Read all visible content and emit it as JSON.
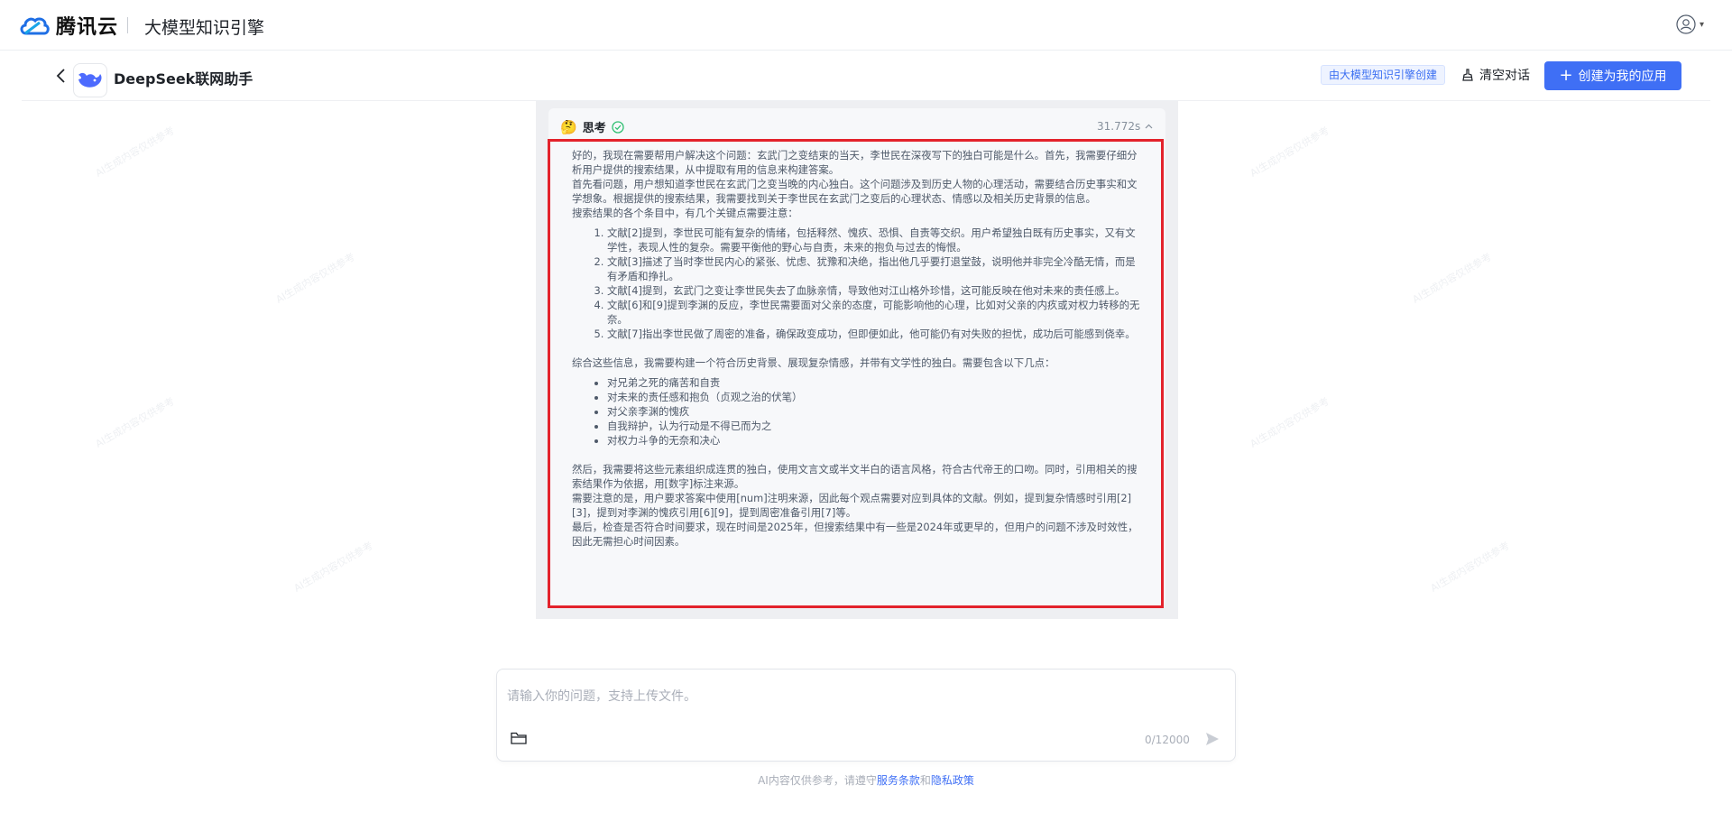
{
  "header": {
    "brand": "腾讯云",
    "product": "大模型知识引擎"
  },
  "subheader": {
    "app_title": "DeepSeek联网助手",
    "creator_tag": "由大模型知识引擎创建",
    "clear_label": "清空对话",
    "create_label": "创建为我的应用"
  },
  "thinking": {
    "emoji": "🤔",
    "label": "思考",
    "duration": "31.772s",
    "intro": [
      "好的，我现在需要帮用户解决这个问题：玄武门之变结束的当天，李世民在深夜写下的独白可能是什么。首先，我需要仔细分析用户提供的搜索结果，从中提取有用的信息来构建答案。",
      "首先看问题，用户想知道李世民在玄武门之变当晚的内心独白。这个问题涉及到历史人物的心理活动，需要结合历史事实和文学想象。根据提供的搜索结果，我需要找到关于李世民在玄武门之变后的心理状态、情感以及相关历史背景的信息。",
      "搜索结果的各个条目中，有几个关键点需要注意："
    ],
    "points": [
      "文献[2]提到，李世民可能有复杂的情绪，包括释然、愧疚、恐惧、自责等交织。用户希望独白既有历史事实，又有文学性，表现人性的复杂。需要平衡他的野心与自责，未来的抱负与过去的悔恨。",
      "文献[3]描述了当时李世民内心的紧张、忧虑、犹豫和决绝，指出他几乎要打退堂鼓，说明他并非完全冷酷无情，而是有矛盾和挣扎。",
      "文献[4]提到，玄武门之变让李世民失去了血脉亲情，导致他对江山格外珍惜，这可能反映在他对未来的责任感上。",
      "文献[6]和[9]提到李渊的反应，李世民需要面对父亲的态度，可能影响他的心理，比如对父亲的内疚或对权力转移的无奈。",
      "文献[7]指出李世民做了周密的准备，确保政变成功，但即便如此，他可能仍有对失败的担忧，成功后可能感到侥幸。"
    ],
    "summary": "综合这些信息，我需要构建一个符合历史背景、展现复杂情感，并带有文学性的独白。需要包含以下几点：",
    "bullets": [
      "对兄弟之死的痛苦和自责",
      "对未来的责任感和抱负（贞观之治的伏笔）",
      "对父亲李渊的愧疚",
      "自我辩护，认为行动是不得已而为之",
      "对权力斗争的无奈和决心"
    ],
    "outro": [
      "然后，我需要将这些元素组织成连贯的独白，使用文言文或半文半白的语言风格，符合古代帝王的口吻。同时，引用相关的搜索结果作为依据，用[数字]标注来源。",
      "需要注意的是，用户要求答案中使用[num]注明来源，因此每个观点需要对应到具体的文献。例如，提到复杂情感时引用[2][3]，提到对李渊的愧疚引用[6][9]，提到周密准备引用[7]等。",
      "最后，检查是否符合时间要求，现在时间是2025年，但搜索结果中有一些是2024年或更早的，但用户的问题不涉及时效性，因此无需担心时间因素。"
    ]
  },
  "input": {
    "placeholder": "请输入你的问题，支持上传文件。",
    "value": "",
    "char_count": "0/12000"
  },
  "footer": {
    "prefix": "AI内容仅供参考，请遵守",
    "terms": "服务条款",
    "and": "和",
    "privacy": "隐私政策"
  },
  "colors": {
    "accent": "#3f6ff5",
    "highlight_border": "#e3222b",
    "success": "#2fbf71"
  }
}
